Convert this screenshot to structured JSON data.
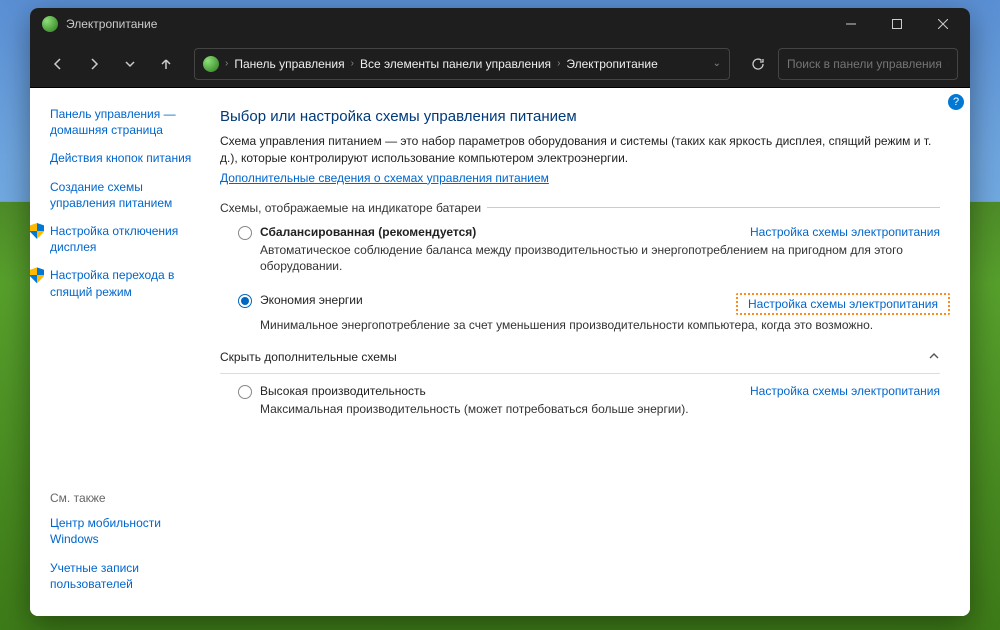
{
  "window": {
    "title": "Электропитание"
  },
  "nav": {
    "breadcrumbs": [
      "Панель управления",
      "Все элементы панели управления",
      "Электропитание"
    ]
  },
  "search": {
    "placeholder": "Поиск в панели управления"
  },
  "sidebar": {
    "items": [
      {
        "label": "Панель управления — домашняя страница",
        "has_shield": false
      },
      {
        "label": "Действия кнопок питания",
        "has_shield": false
      },
      {
        "label": "Создание схемы управления питанием",
        "has_shield": false
      },
      {
        "label": "Настройка отключения дисплея",
        "has_shield": true
      },
      {
        "label": "Настройка перехода в спящий режим",
        "has_shield": true
      }
    ],
    "footer_heading": "См. также",
    "footer_items": [
      {
        "label": "Центр мобильности Windows"
      },
      {
        "label": "Учетные записи пользователей"
      }
    ]
  },
  "main": {
    "heading": "Выбор или настройка схемы управления питанием",
    "intro": "Схема управления питанием — это набор параметров оборудования и системы (таких как яркость дисплея, спящий режим и т. д.), которые контролируют использование компьютером электроэнергии.",
    "intro_link": "Дополнительные сведения о схемах управления питанием",
    "group1_title": "Схемы, отображаемые на индикаторе батареи",
    "plans_primary": [
      {
        "name": "Сбалансированная (рекомендуется)",
        "bold": true,
        "selected": false,
        "configure": "Настройка схемы электропитания",
        "desc": "Автоматическое соблюдение баланса между производительностью и энергопотреблением на пригодном для этого оборудовании.",
        "highlighted": false
      },
      {
        "name": "Экономия энергии",
        "bold": false,
        "selected": true,
        "configure": "Настройка схемы электропитания",
        "desc": "Минимальное энергопотребление за счет уменьшения производительности компьютера, когда это возможно.",
        "highlighted": true
      }
    ],
    "collapse_label": "Скрыть дополнительные схемы",
    "plans_extra": [
      {
        "name": "Высокая производительность",
        "bold": false,
        "selected": false,
        "configure": "Настройка схемы электропитания",
        "desc": "Максимальная производительность (может потребоваться больше энергии).",
        "highlighted": false
      }
    ]
  }
}
